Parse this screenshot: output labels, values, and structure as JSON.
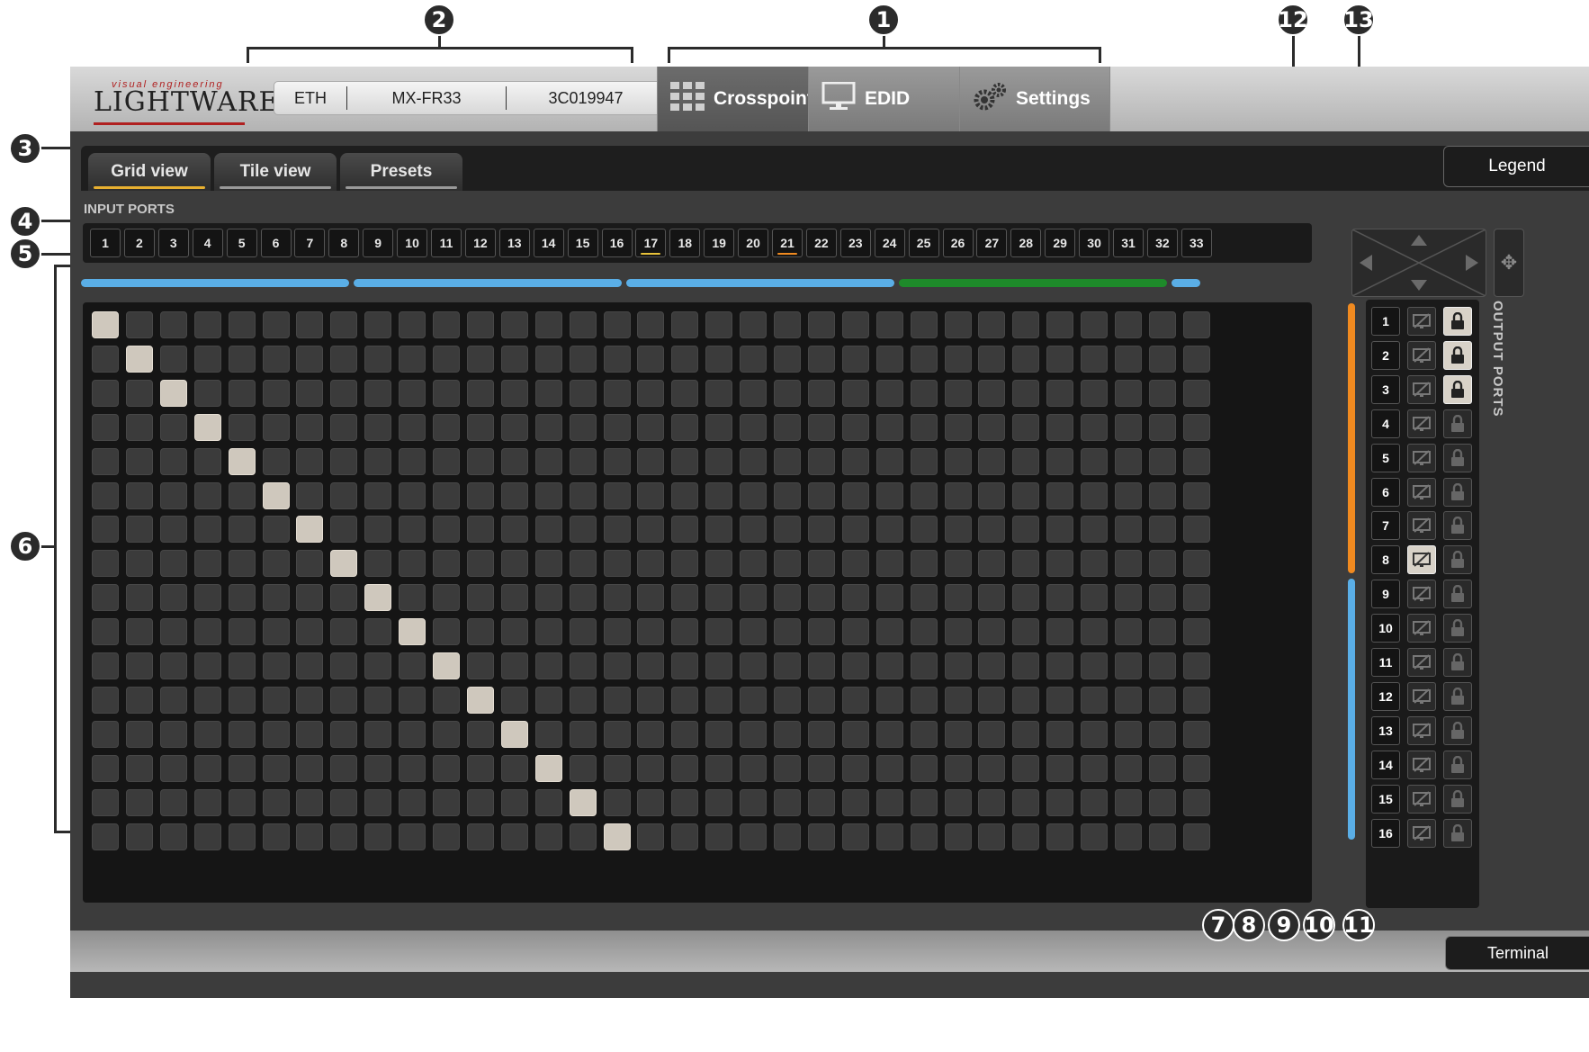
{
  "callouts": [
    "1",
    "2",
    "3",
    "4",
    "5",
    "6",
    "7",
    "8",
    "9",
    "10",
    "11",
    "12",
    "13"
  ],
  "header": {
    "logo_small": "visual engineering",
    "logo_main": "LIGHTWARE",
    "device": {
      "interface": "ETH",
      "model": "MX-FR33",
      "serial": "3C019947"
    },
    "tabs": [
      {
        "label": "Crosspoint",
        "icon": "crosspoint-grid-icon",
        "active": true
      },
      {
        "label": "EDID",
        "icon": "monitor-icon",
        "active": false
      },
      {
        "label": "Settings",
        "icon": "gears-icon",
        "active": false
      }
    ]
  },
  "views": {
    "tabs": [
      {
        "label": "Grid view",
        "active": true
      },
      {
        "label": "Tile view",
        "active": false
      },
      {
        "label": "Presets",
        "active": false
      }
    ],
    "legend_label": "Legend"
  },
  "inputs": {
    "title": "INPUT PORTS",
    "ports": [
      "1",
      "2",
      "3",
      "4",
      "5",
      "6",
      "7",
      "8",
      "9",
      "10",
      "11",
      "12",
      "13",
      "14",
      "15",
      "16",
      "17",
      "18",
      "19",
      "20",
      "21",
      "22",
      "23",
      "24",
      "25",
      "26",
      "27",
      "28",
      "29",
      "30",
      "31",
      "32",
      "33"
    ],
    "highlights": {
      "17": "#e8c23a",
      "21": "#f08a20"
    }
  },
  "groups": {
    "colors": [
      "#5aaee6",
      "#5aaee6",
      "#5aaee6",
      "#1e8a2a",
      "#5aaee6"
    ]
  },
  "grid": {
    "columns": 33,
    "rows": 16,
    "connections": [
      [
        1,
        1
      ],
      [
        2,
        2
      ],
      [
        3,
        3
      ],
      [
        4,
        4
      ],
      [
        5,
        5
      ],
      [
        6,
        6
      ],
      [
        7,
        7
      ],
      [
        8,
        8
      ],
      [
        9,
        9
      ],
      [
        10,
        10
      ],
      [
        11,
        11
      ],
      [
        12,
        12
      ],
      [
        13,
        13
      ],
      [
        14,
        14
      ],
      [
        15,
        15
      ],
      [
        16,
        16
      ]
    ]
  },
  "outputs": {
    "title": "OUTPUT PORTS",
    "ports": [
      "1",
      "2",
      "3",
      "4",
      "5",
      "6",
      "7",
      "8",
      "9",
      "10",
      "11",
      "12",
      "13",
      "14",
      "15",
      "16"
    ],
    "muted": [
      8
    ],
    "locked": [
      1,
      2,
      3
    ]
  },
  "side_strip": {
    "top_color": "#f08a20",
    "bottom_color": "#5aaee6"
  },
  "footer": {
    "terminal_label": "Terminal"
  }
}
